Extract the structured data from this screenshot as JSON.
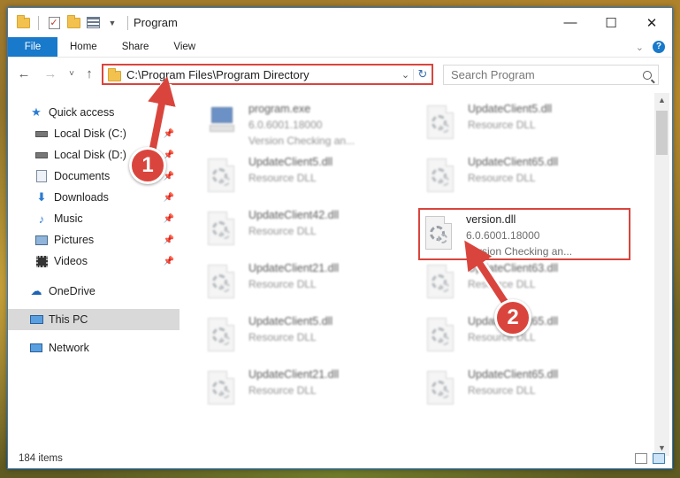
{
  "window": {
    "title": "Program",
    "controls": {
      "minimize": "—",
      "maximize": "☐",
      "close": "✕"
    }
  },
  "ribbon": {
    "tabs": [
      "File",
      "Home",
      "Share",
      "View"
    ],
    "help": "?"
  },
  "nav": {
    "back": "←",
    "forward": "→",
    "recent": "˅",
    "up": "↑",
    "address": "C:\\Program Files\\Program Directory",
    "search_placeholder": "Search Program"
  },
  "sidebar": {
    "items": [
      {
        "label": "Quick access",
        "icon": "star-icon",
        "pinned": false
      },
      {
        "label": "Local Disk (C:)",
        "icon": "drive-icon",
        "pinned": true
      },
      {
        "label": "Local Disk (D:)",
        "icon": "drive-icon",
        "pinned": true
      },
      {
        "label": "Documents",
        "icon": "documents-icon",
        "pinned": true
      },
      {
        "label": "Downloads",
        "icon": "download-icon",
        "pinned": true
      },
      {
        "label": "Music",
        "icon": "music-icon",
        "pinned": true
      },
      {
        "label": "Pictures",
        "icon": "pictures-icon",
        "pinned": true
      },
      {
        "label": "Videos",
        "icon": "videos-icon",
        "pinned": true
      },
      {
        "label": "OneDrive",
        "icon": "cloud-icon",
        "pinned": false
      },
      {
        "label": "This PC",
        "icon": "computer-icon",
        "pinned": false,
        "selected": true
      },
      {
        "label": "Network",
        "icon": "network-icon",
        "pinned": false
      }
    ]
  },
  "files": {
    "left": [
      {
        "name": "program.exe",
        "line2": "6.0.6001.18000",
        "line3": "Version Checking an...",
        "type": "exe"
      },
      {
        "name": "UpdateClient5.dll",
        "line2": "Resource DLL"
      },
      {
        "name": "UpdateClient42.dll",
        "line2": "Resource DLL"
      },
      {
        "name": "UpdateClient21.dll",
        "line2": "Resource DLL"
      },
      {
        "name": "UpdateClient5.dll",
        "line2": "Resource DLL"
      },
      {
        "name": "UpdateClient21.dll",
        "line2": "Resource DLL"
      }
    ],
    "right": [
      {
        "name": "UpdateClient5.dll",
        "line2": "Resource DLL"
      },
      {
        "name": "UpdateClient65.dll",
        "line2": "Resource DLL"
      },
      {
        "name": "version.dll",
        "line2": "6.0.6001.18000",
        "line3": "Version Checking an...",
        "highlight": true
      },
      {
        "name": "UpdateClient63.dll",
        "line2": "Resource DLL"
      },
      {
        "name": "UpdateClient65.dll",
        "line2": "Resource DLL"
      },
      {
        "name": "UpdateClient65.dll",
        "line2": "Resource DLL"
      }
    ]
  },
  "status": {
    "item_count": "184 items"
  },
  "annotations": {
    "step1": "1",
    "step2": "2",
    "color": "#d9453d"
  }
}
